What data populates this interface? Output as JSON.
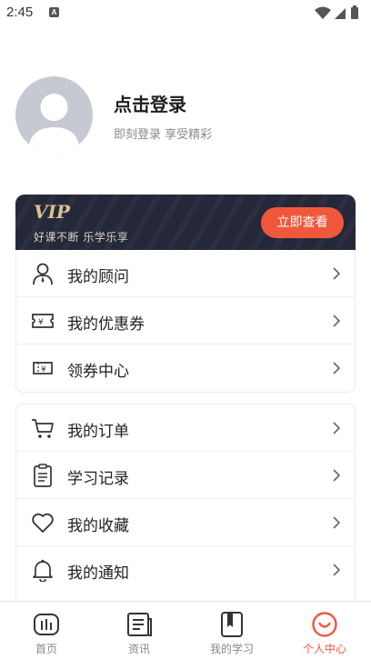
{
  "status_bar": {
    "time": "2:45",
    "badge": "A"
  },
  "profile": {
    "title": "点击登录",
    "subtitle": "即刻登录 享受精彩"
  },
  "vip": {
    "logo_text": "VIP",
    "slogan": "好课不断 乐学乐享",
    "button": "立即查看",
    "accent": "#f0583c",
    "bg": "#252838"
  },
  "menu_group_1": [
    {
      "label": "我的顾问",
      "icon": "advisor-icon"
    },
    {
      "label": "我的优惠券",
      "icon": "coupon-icon"
    },
    {
      "label": "领券中心",
      "icon": "coupon-center-icon"
    }
  ],
  "menu_group_2": [
    {
      "label": "我的订单",
      "icon": "cart-icon"
    },
    {
      "label": "学习记录",
      "icon": "clipboard-icon"
    },
    {
      "label": "我的收藏",
      "icon": "heart-icon"
    },
    {
      "label": "我的通知",
      "icon": "bell-icon"
    }
  ],
  "bottom_nav": [
    {
      "label": "首页",
      "icon": "home-icon"
    },
    {
      "label": "资讯",
      "icon": "news-icon"
    },
    {
      "label": "我的学习",
      "icon": "book-icon"
    },
    {
      "label": "个人中心",
      "icon": "profile-smile-icon",
      "active": true
    }
  ]
}
